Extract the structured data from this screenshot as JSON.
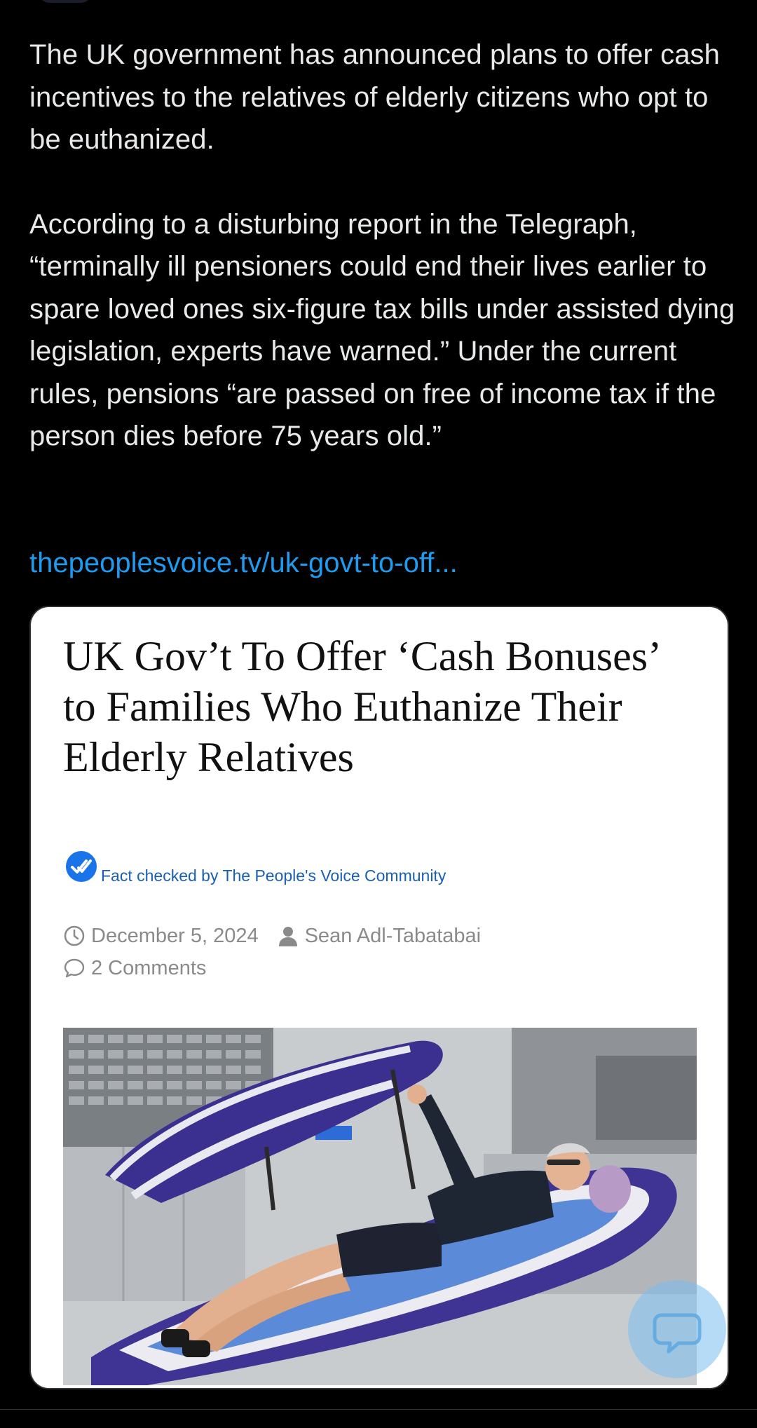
{
  "tweet": {
    "paragraph1": "The UK government has announced plans to offer cash incentives to the relatives of elderly citizens who opt to be euthanized.",
    "paragraph2": "According to a disturbing report in the Telegraph, “terminally ill pensioners could end their lives earlier to spare loved ones six-figure tax bills under assisted dying legislation, experts have warned.” Under the current rules, pensions “are passed on free of income tax if the person dies before 75 years old.”",
    "link_text": "thepeoplesvoice.tv/uk-govt-to-off..."
  },
  "card": {
    "title": "UK Gov’t To Offer ‘Cash Bonuses’ to Families Who Euthanize Their Elderly Relatives",
    "fact_check": "Fact checked by The People's Voice Community",
    "date": "December 5, 2024",
    "author": "Sean Adl-Tabatabai",
    "comments": "2 Comments",
    "image_icon": "article-photo"
  },
  "icons": {
    "clock": "clock-icon",
    "user": "user-icon",
    "comment": "comment-icon",
    "verified": "verified-check-icon",
    "chat": "chat-bubble-icon"
  },
  "colors": {
    "background": "#000000",
    "text": "#e7e9ea",
    "link": "#1d9bf0",
    "card_bg": "#ffffff",
    "fact_blue": "#1a5fb4",
    "meta_gray": "#8a8a8a"
  }
}
